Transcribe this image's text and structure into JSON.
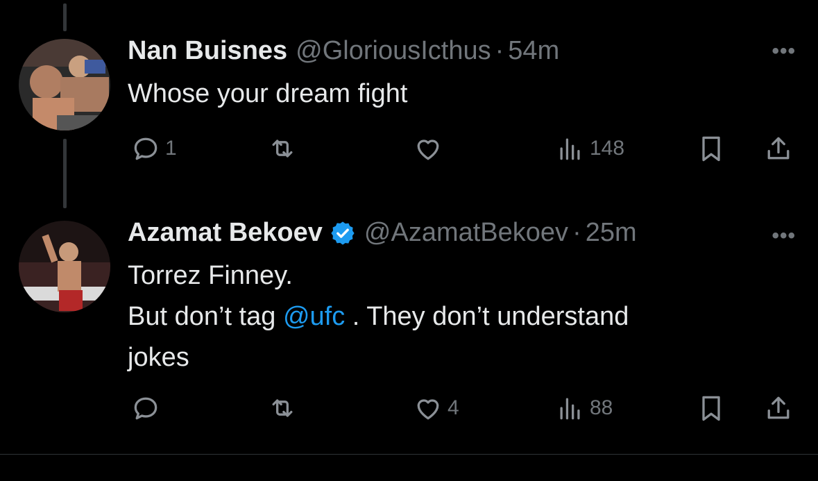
{
  "tweets": [
    {
      "name": "Nan Buisnes",
      "handle": "@GloriousIcthus",
      "separator": "·",
      "time": "54m",
      "verified": false,
      "text_lines": [
        "Whose your dream fight"
      ],
      "more": "•••",
      "reply_count": "1",
      "retweet_count": "",
      "like_count": "",
      "view_count": "148"
    },
    {
      "name": "Azamat Bekoev",
      "handle": "@AzamatBekoev",
      "separator": "·",
      "time": "25m",
      "verified": true,
      "text_line1": "Torrez Finney.",
      "text_line2_pre": "But don’t tag ",
      "text_line2_mention": "@ufc",
      "text_line2_post": " . They don’t understand",
      "text_line3": "jokes",
      "more": "•••",
      "reply_count": "",
      "retweet_count": "",
      "like_count": "4",
      "view_count": "88"
    }
  ],
  "icons": {
    "reply": "reply-icon",
    "retweet": "retweet-icon",
    "like": "heart-icon",
    "views": "views-icon",
    "bookmark": "bookmark-icon",
    "share": "share-icon",
    "verified": "verified-badge-icon"
  },
  "colors": {
    "background": "#000000",
    "text": "#e7e9ea",
    "muted": "#71767b",
    "link": "#1d9bf0",
    "verified": "#1d9bf0"
  }
}
